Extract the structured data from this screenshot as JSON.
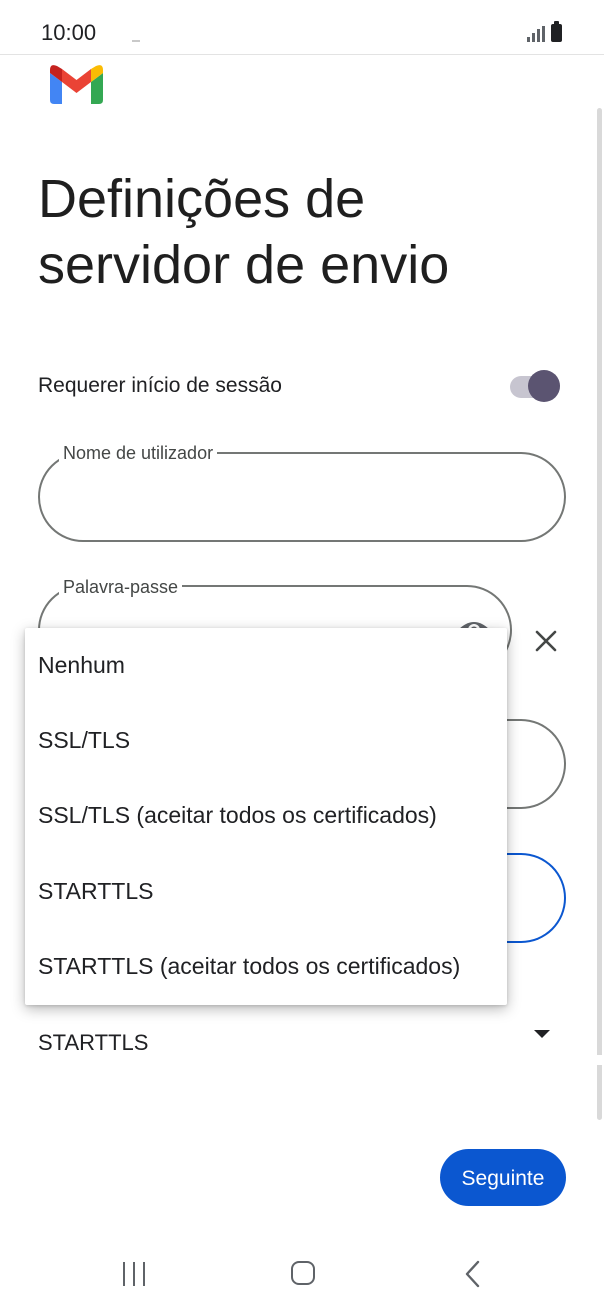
{
  "status_bar": {
    "time": "10:00"
  },
  "page": {
    "title": "Definições de servidor de envio"
  },
  "login_toggle": {
    "label": "Requerer início de sessão",
    "on": true
  },
  "username_field": {
    "label": "Nome de utilizador",
    "value": ""
  },
  "password_field": {
    "label": "Palavra-passe",
    "value": ""
  },
  "security": {
    "selected": "STARTTLS",
    "options": [
      "Nenhum",
      "SSL/TLS",
      "SSL/TLS (aceitar todos os certificados)",
      "STARTTLS",
      "STARTTLS (aceitar todos os certificados)"
    ]
  },
  "actions": {
    "next_label": "Seguinte"
  },
  "colors": {
    "accent": "#0b57d0",
    "toggle_knob": "#5b5471",
    "toggle_track": "#c7c5d0"
  },
  "icons": {
    "app_logo": "gmail-logo-icon",
    "visibility": "eye-icon",
    "clear": "close-icon",
    "nav_recents": "recents-icon",
    "nav_home": "home-icon",
    "nav_back": "back-icon"
  }
}
